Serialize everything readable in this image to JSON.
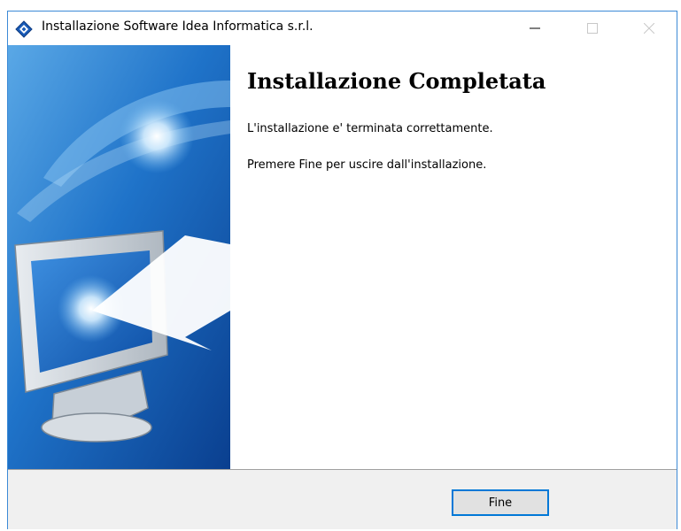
{
  "window": {
    "title": "Installazione Software Idea Informatica s.r.l.",
    "accent_color": "#0078d7"
  },
  "titlebar_buttons": {
    "minimize_icon": "minimize-icon",
    "maximize_icon": "maximize-icon",
    "close_icon": "close-icon"
  },
  "content": {
    "heading": "Installazione Completata",
    "line1": "L'installazione e' terminata correttamente.",
    "line2": "Premere Fine per uscire dall'installazione."
  },
  "footer": {
    "finish_label": "Fine"
  }
}
